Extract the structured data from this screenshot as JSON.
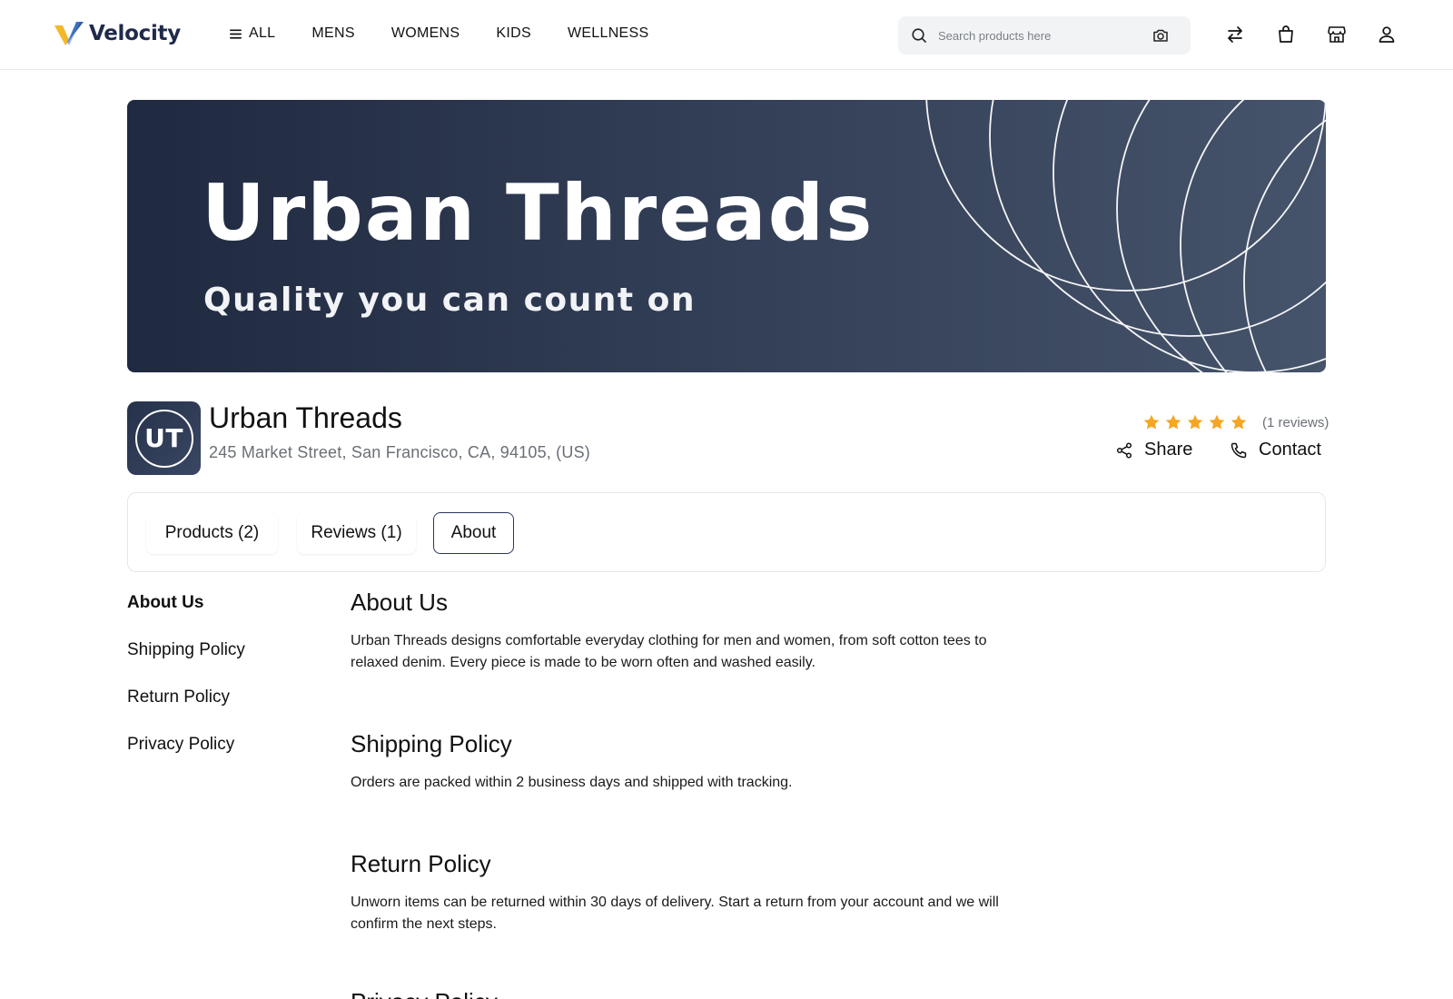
{
  "header": {
    "logo_text": "Velocity",
    "nav": [
      {
        "label": "ALL"
      },
      {
        "label": "MENS"
      },
      {
        "label": "WOMENS"
      },
      {
        "label": "KIDS"
      },
      {
        "label": "WELLNESS"
      }
    ],
    "search_placeholder": "Search products here",
    "icons": [
      "compare-icon",
      "cart-icon",
      "store-icon",
      "user-icon"
    ]
  },
  "banner": {
    "title": "Urban Threads",
    "subtitle": "Quality you can count on"
  },
  "store": {
    "initials": "UT",
    "name": "Urban Threads",
    "address": "245 Market Street, San Francisco, CA, 94105, (US)",
    "rating": 5,
    "review_count_label": "(1 reviews)",
    "share_label": "Share",
    "contact_label": "Contact"
  },
  "tabs": [
    {
      "label": "Products (2)",
      "active": false
    },
    {
      "label": "Reviews (1)",
      "active": false
    },
    {
      "label": "About",
      "active": true
    }
  ],
  "sidenav": [
    {
      "label": "About Us",
      "active": true
    },
    {
      "label": "Shipping Policy",
      "active": false
    },
    {
      "label": "Return Policy",
      "active": false
    },
    {
      "label": "Privacy Policy",
      "active": false
    }
  ],
  "sections": [
    {
      "title": "About Us",
      "body": "Urban Threads designs comfortable everyday clothing for men and women, from soft cotton tees to relaxed denim. Every piece is made to be worn often and washed easily."
    },
    {
      "title": "Shipping Policy",
      "body": "Orders are packed within 2 business days and shipped with tracking."
    },
    {
      "title": "Return Policy",
      "body": "Unworn items can be returned within 30 days of delivery. Start a return from your account and we will confirm the next steps."
    },
    {
      "title": "Privacy Policy",
      "body": ""
    }
  ],
  "colors": {
    "accent": "#2b3560",
    "star": "#f5a623",
    "logo_yellow": "#f5b72a",
    "logo_blue": "#2f5ea8"
  }
}
